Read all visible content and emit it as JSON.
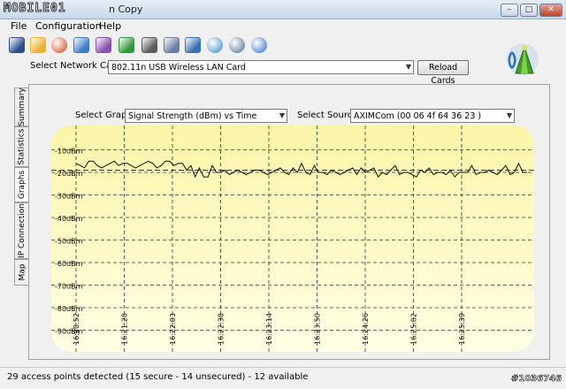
{
  "titlebar": {
    "logo_text": "MOBILE01",
    "title_suffix": "n Copy",
    "minimize_glyph": "–",
    "maximize_glyph": "□",
    "close_glyph": "✕"
  },
  "menu": [
    "File",
    "Configuration",
    "Help"
  ],
  "toolbar": {
    "icons": [
      "save-icon",
      "open-folder-icon",
      "record-icon",
      "network-icon",
      "network-purple-icon",
      "play-export-icon",
      "printer-icon",
      "print-preview-icon",
      "check-icon",
      "globe-icon",
      "support-icon",
      "help-icon"
    ],
    "colors": [
      "#2a4f8a",
      "#f0b030",
      "#d04010",
      "#3c7fc8",
      "#8a4fb0",
      "#2f9a3a",
      "#5a5a5a",
      "#6a7fa8",
      "#3a6fb0",
      "#2f8ad0",
      "#4a6a8a",
      "#2a68c8"
    ]
  },
  "network": {
    "label": "Select Network Card",
    "value": "802.11n USB Wireless LAN Card",
    "reload_label": "Reload Cards"
  },
  "tabs": [
    "Summary",
    "Statistics",
    "Graphs",
    "IP Connection",
    "Map"
  ],
  "active_tab": "Graphs",
  "graph": {
    "select_graph_label": "Select Graph",
    "select_graph_value": "Signal Strength (dBm) vs Time",
    "select_source_label": "Select Source",
    "select_source_value": "AXIMCom (00 06 4f 64 36 23 )"
  },
  "chart_data": {
    "type": "line",
    "y_tick_labels": [
      "-10dBm",
      "-20dBm",
      "-30dBm",
      "-40dBm",
      "-50dBm",
      "-60dBm",
      "-70dBm",
      "-80dBm",
      "-90dBm"
    ],
    "y_ticks": [
      -10,
      -20,
      -30,
      -40,
      -50,
      -60,
      -70,
      -80,
      -90
    ],
    "ylim": [
      -100,
      0
    ],
    "x_tick_labels": [
      "16:20:52",
      "16:21:28",
      "16:22:03",
      "16:22:38",
      "16:23:14",
      "16:23:50",
      "16:24:26",
      "16:25:02",
      "16:25:39"
    ],
    "grid": true,
    "reference_level": -19,
    "series": [
      {
        "values": [
          -16,
          -17,
          -18,
          -15,
          -15,
          -17,
          -18,
          -17,
          -16,
          -15,
          -17,
          -16,
          -16,
          -17,
          -18,
          -17,
          -16,
          -15,
          -16,
          -18,
          -17,
          -15,
          -15,
          -17,
          -16,
          -16,
          -19,
          -17,
          -22,
          -18,
          -22,
          -22,
          -17,
          -20,
          -20,
          -19,
          -21,
          -20,
          -19,
          -20,
          -21,
          -20,
          -19,
          -19,
          -20,
          -21,
          -20,
          -19,
          -18,
          -20,
          -21,
          -18,
          -20,
          -16,
          -20,
          -21,
          -17,
          -20,
          -20,
          -21,
          -19,
          -20,
          -21,
          -20,
          -19,
          -18,
          -21,
          -18,
          -20,
          -19,
          -18,
          -22,
          -20,
          -21,
          -19,
          -17,
          -21,
          -20,
          -20,
          -21,
          -22,
          -19,
          -20,
          -18,
          -21,
          -20,
          -20,
          -21,
          -19,
          -22,
          -20,
          -20,
          -20,
          -17,
          -21,
          -20,
          -20,
          -19,
          -20,
          -21,
          -19,
          -17,
          -21,
          -20,
          -16,
          -20,
          -20
        ]
      }
    ]
  },
  "status": {
    "text": "29 access points detected (15 secure - 14 unsecured) - 12 available",
    "watermark": "#1036746"
  }
}
